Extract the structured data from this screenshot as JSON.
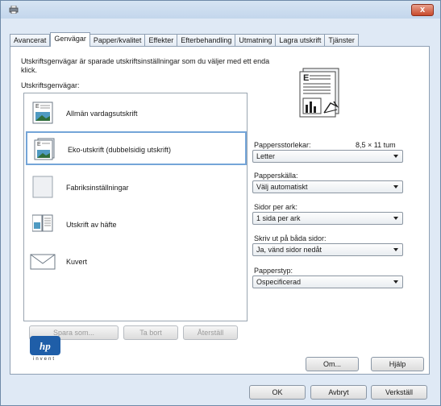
{
  "window": {
    "title_icon": "printer-icon",
    "close_label": "x"
  },
  "tabs": [
    "Avancerat",
    "Genvägar",
    "Papper/kvalitet",
    "Effekter",
    "Efterbehandling",
    "Utmatning",
    "Lagra utskrift",
    "Tjänster"
  ],
  "description": "Utskriftsgenvägar är sparade utskriftsinställningar som du väljer med ett enda klick.",
  "shortcuts_label": "Utskriftsgenvägar:",
  "shortcuts": [
    {
      "label": "Allmän vardagsutskrift",
      "icon": "document-general-icon"
    },
    {
      "label": "Eko-utskrift (dubbelsidig utskrift)",
      "icon": "document-duplex-icon",
      "selected": true
    },
    {
      "label": "Fabriksinställningar",
      "icon": "factory-settings-icon"
    },
    {
      "label": "Utskrift av häfte",
      "icon": "booklet-icon"
    },
    {
      "label": "Kuvert",
      "icon": "envelope-icon"
    }
  ],
  "fields": {
    "paper_size": {
      "label": "Pappersstorlekar:",
      "value": "Letter",
      "dimension": "8,5 × 11 tum"
    },
    "paper_source": {
      "label": "Papperskälla:",
      "value": "Välj automatiskt"
    },
    "pages_per_sheet": {
      "label": "Sidor per ark:",
      "value": "1 sida per ark"
    },
    "print_both_sides": {
      "label": "Skriv ut på båda sidor:",
      "value": "Ja, vänd sidor nedåt"
    },
    "paper_type": {
      "label": "Papperstyp:",
      "value": "Ospecificerad"
    }
  },
  "list_buttons": {
    "save_as": "Spara som...",
    "delete": "Ta bort",
    "reset": "Återställ"
  },
  "logo": {
    "text": "hp",
    "tagline": "invent"
  },
  "footer": {
    "about": "Om...",
    "help": "Hjälp",
    "ok": "OK",
    "cancel": "Avbryt",
    "apply": "Verkställ"
  }
}
